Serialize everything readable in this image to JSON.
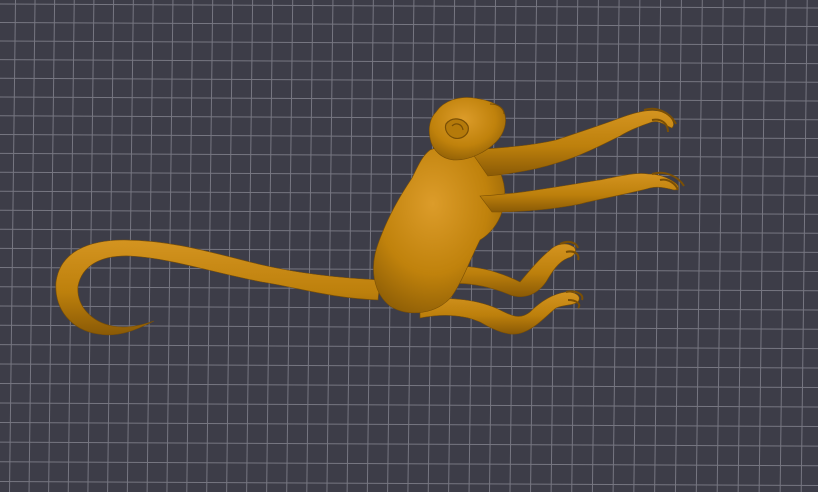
{
  "viewport": {
    "background_color": "#3d3d48",
    "grid_color": "#8a8a94",
    "model": {
      "name": "monkey-model",
      "material_color": "#c0820c",
      "shadow_color": "#8a5a06",
      "highlight_color": "#e0a233"
    }
  }
}
